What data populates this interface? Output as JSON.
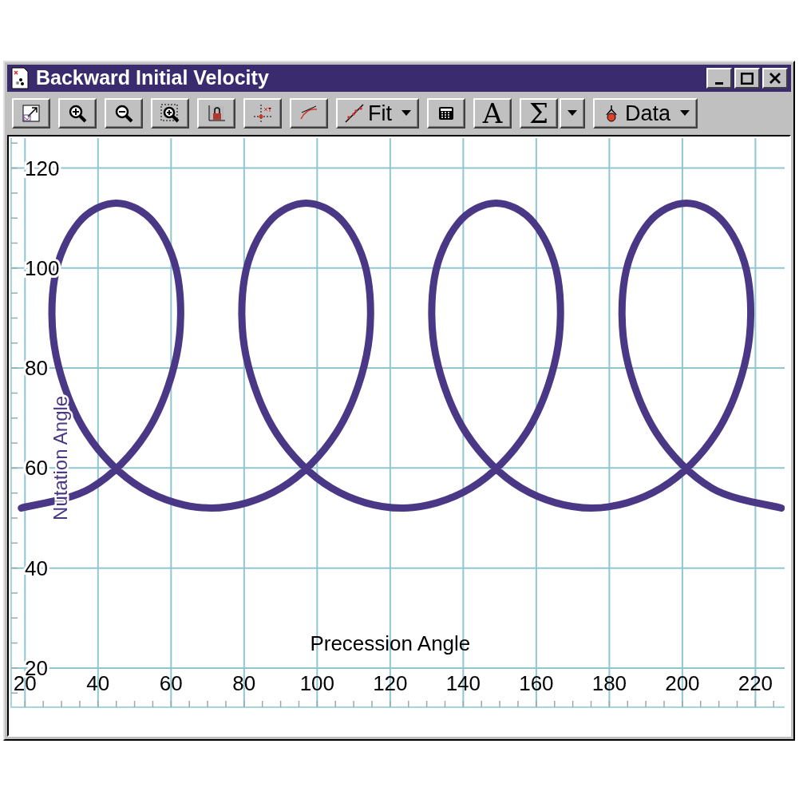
{
  "window": {
    "title": "Backward Initial Velocity"
  },
  "toolbar": [
    {
      "kind": "autoscale"
    },
    {
      "kind": "zoom-in"
    },
    {
      "kind": "zoom-out"
    },
    {
      "kind": "zoom-box"
    },
    {
      "kind": "lock"
    },
    {
      "kind": "examine"
    },
    {
      "kind": "tangent"
    },
    {
      "kind": "fit-dropdown",
      "label": "Fit"
    },
    {
      "kind": "calculator"
    },
    {
      "kind": "glyph",
      "label": "A"
    },
    {
      "kind": "glyph",
      "label": "Σ"
    },
    {
      "kind": "caret"
    },
    {
      "kind": "data-dropdown",
      "label": "Data"
    }
  ],
  "graph": {
    "chart_data": {
      "type": "line",
      "grid": true,
      "xlabel": "Precession Angle",
      "ylabel": "Nutation Angle",
      "xlim": [
        16,
        228
      ],
      "ylim": [
        12,
        126
      ],
      "xticks": [
        20,
        40,
        60,
        80,
        100,
        120,
        140,
        160,
        180,
        200,
        220
      ],
      "yticks": [
        20,
        40,
        60,
        80,
        100,
        120
      ],
      "x": [
        19,
        38.1,
        53.2,
        61.5,
        61.9,
        55.4,
        45.0,
        34.6,
        28.1,
        28.5,
        36.8,
        51.9,
        71.0,
        90.1,
        105.2,
        113.5,
        113.9,
        107.4,
        97.0,
        86.6,
        80.1,
        80.5,
        88.8,
        103.9,
        123.0,
        142.1,
        157.2,
        165.5,
        165.9,
        159.4,
        149.0,
        138.6,
        132.1,
        132.5,
        140.8,
        155.9,
        175.1,
        194.2,
        209.3,
        217.6,
        218.0,
        211.5,
        201.1,
        190.7,
        184.2,
        184.6,
        192.9,
        208.0,
        227.1
      ],
      "series": [
        {
          "color": "#4a3785",
          "values": [
            52,
            56,
            67,
            82.5,
            98,
            109,
            113,
            109,
            98,
            82.5,
            67,
            56,
            52,
            56,
            67,
            82.5,
            98,
            109,
            113,
            109,
            98,
            82.5,
            67,
            56,
            52,
            56,
            67,
            82.5,
            98,
            109,
            113,
            109,
            98,
            82.5,
            67,
            56,
            52,
            56,
            67,
            82.5,
            98,
            109,
            113,
            109,
            98,
            82.5,
            67,
            56,
            52
          ]
        }
      ]
    }
  }
}
